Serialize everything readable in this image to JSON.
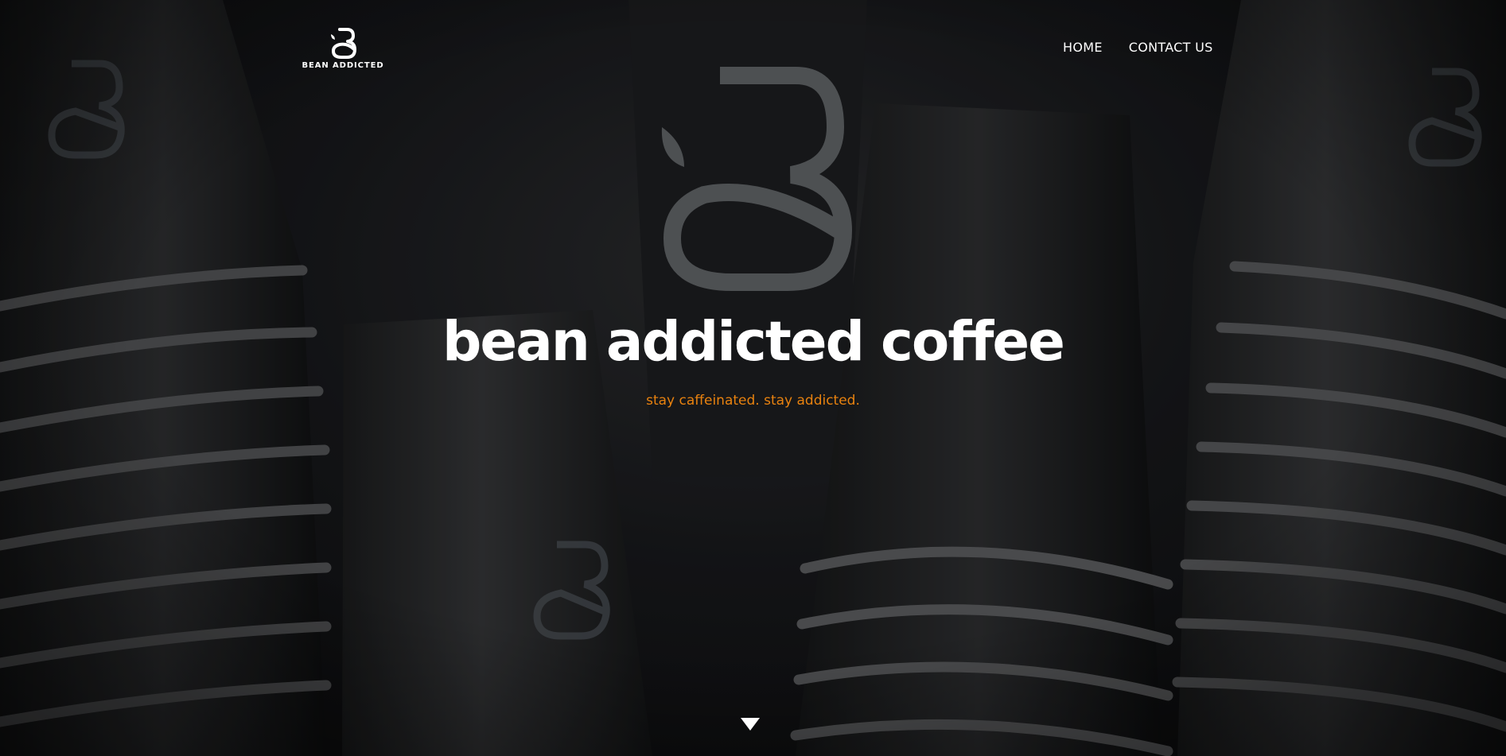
{
  "brand": {
    "logo_text": "BEAN ADDICTED",
    "logo_icon": "bean-addicted-logo-icon"
  },
  "nav": {
    "items": [
      {
        "label": "HOME"
      },
      {
        "label": "CONTACT US"
      }
    ]
  },
  "hero": {
    "title": "bean addicted coffee",
    "tagline": "stay caffeinated. stay addicted.",
    "scroll_icon": "caret-down-icon"
  },
  "colors": {
    "accent": "#e8820f",
    "text": "#ffffff",
    "background": "#111214"
  }
}
